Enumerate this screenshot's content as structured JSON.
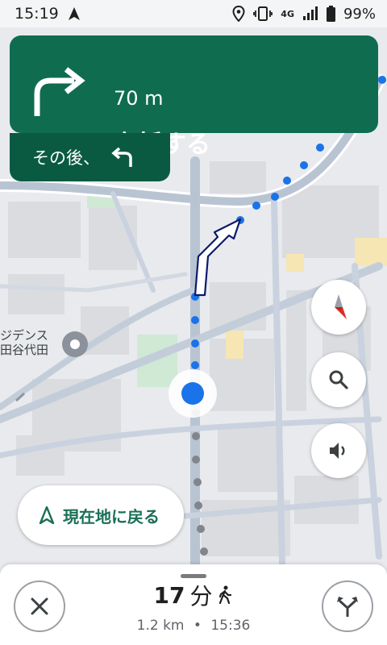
{
  "status_bar": {
    "time": "15:19",
    "battery": "99%",
    "network": "4G",
    "icons": [
      "navigation-arrow-icon",
      "location-icon",
      "vibrate-icon",
      "4g-icon",
      "signal-icon",
      "battery-icon"
    ]
  },
  "banner": {
    "distance": "70 m",
    "instruction": "右折する",
    "then_label": "その後、",
    "turn_icon": "turn-right-arrow-icon",
    "then_icon": "turn-left-arrow-icon"
  },
  "map": {
    "place_label_line1": "ジデンス",
    "place_label_line2": "田谷代田"
  },
  "controls": {
    "compass_icon": "compass-icon",
    "search_icon": "search-icon",
    "sound_icon": "sound-icon",
    "recenter_label": "現在地に戻る"
  },
  "bottom": {
    "eta_value": "17",
    "eta_unit": "分",
    "distance": "1.2 km",
    "separator": "•",
    "arrival": "15:36",
    "close_icon": "close-icon",
    "alternate_routes_icon": "route-fork-icon",
    "mode_icon": "walking-icon"
  }
}
